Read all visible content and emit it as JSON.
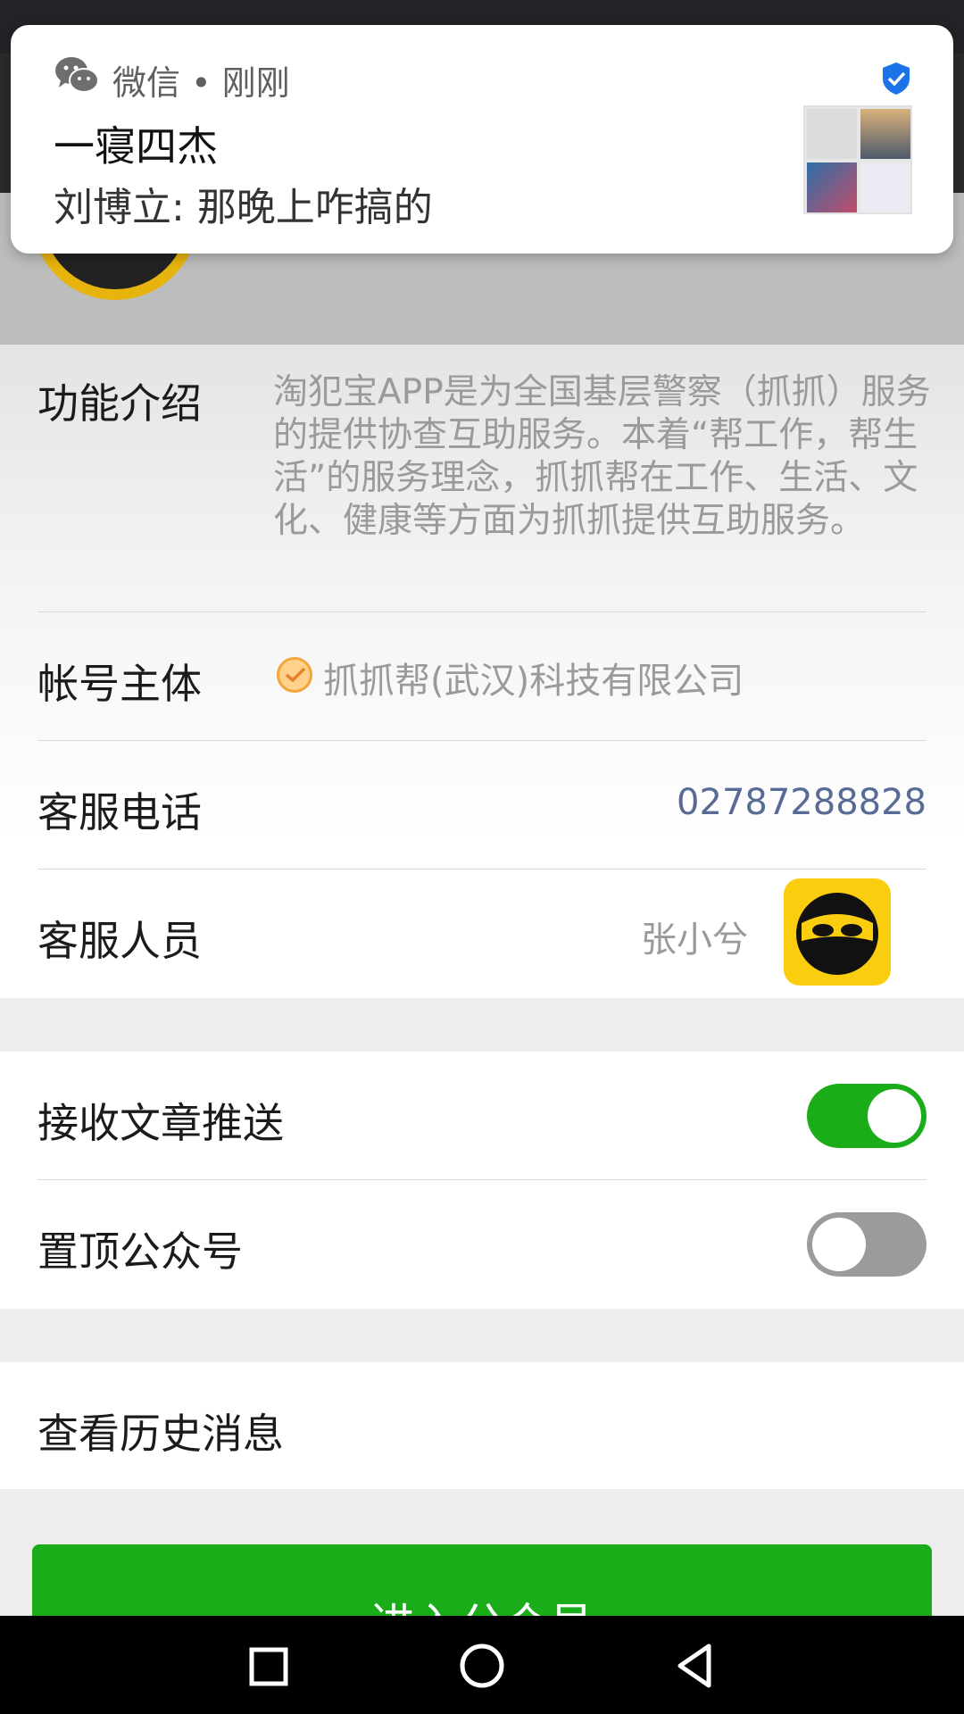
{
  "notification": {
    "app": "微信 • 刚刚",
    "title": "一寝四杰",
    "message": "刘博立: 那晚上咋搞的",
    "app_icon": "wechat-icon",
    "badge_icon": "shield-check-icon"
  },
  "info": {
    "intro": {
      "label": "功能介绍",
      "text": "淘犯宝APP是为全国基层警察（抓抓）服务的提供协查互助服务。本着“帮工作，帮生活”的服务理念，抓抓帮在工作、生活、文化、健康等方面为抓抓提供互助服务。"
    },
    "entity": {
      "label": "帐号主体",
      "value": "抓抓帮(武汉)科技有限公司",
      "icon": "verified-check-icon"
    },
    "phone": {
      "label": "客服电话",
      "value": "02787288828"
    },
    "agent": {
      "label": "客服人员",
      "name": "张小兮",
      "avatar_icon": "masked-bandit-avatar"
    }
  },
  "settings": {
    "receive_articles": {
      "label": "接收文章推送",
      "on": true
    },
    "pin_account": {
      "label": "置顶公众号",
      "on": false
    }
  },
  "history": {
    "label": "查看历史消息"
  },
  "enter_button": {
    "label": "进入公众号"
  },
  "colors": {
    "accent_green": "#1aad19",
    "link_blue": "#576b95",
    "avatar_yellow": "#fbcd0f"
  }
}
